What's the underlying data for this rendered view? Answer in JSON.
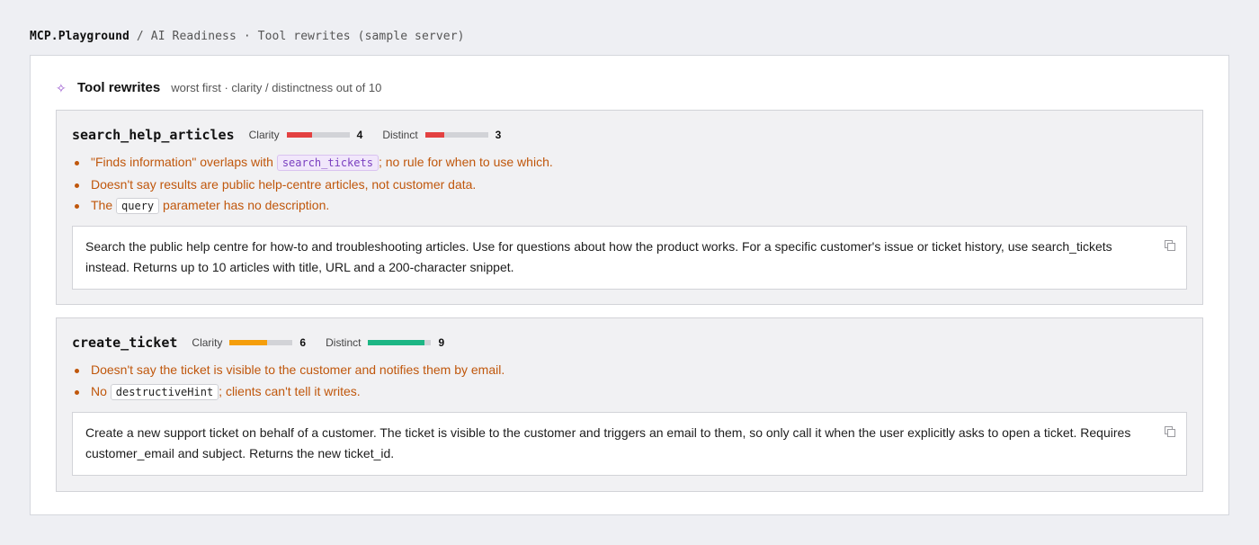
{
  "breadcrumb": {
    "brand": "MCP.Playground",
    "path": "/ AI Readiness · Tool rewrites (sample server)"
  },
  "panel": {
    "icon": "sparkle-icon",
    "title": "Tool rewrites",
    "subtitle": "worst first · clarity / distinctness out of 10"
  },
  "colors": {
    "low": "#e34141",
    "mid": "#f59e0b",
    "high": "#1db684",
    "issue_text": "#c0570c"
  },
  "tools": [
    {
      "name": "search_help_articles",
      "clarity_label": "Clarity",
      "clarity": 4,
      "distinct_label": "Distinct",
      "distinct": 3,
      "issues": [
        {
          "before": "\"Finds information\" overlaps with ",
          "code": "search_tickets",
          "after": "; no rule for when to use which."
        },
        {
          "before": "Doesn't say results are public help-centre articles, not customer data."
        },
        {
          "before": "The ",
          "code": "query",
          "after": " parameter has no description."
        }
      ],
      "rewrite": "Search the public help centre for how-to and troubleshooting articles. Use for questions about how the product works. For a specific customer's issue or ticket history, use search_tickets instead. Returns up to 10 articles with title, URL and a 200-character snippet."
    },
    {
      "name": "create_ticket",
      "clarity_label": "Clarity",
      "clarity": 6,
      "distinct_label": "Distinct",
      "distinct": 9,
      "issues": [
        {
          "before": "Doesn't say the ticket is visible to the customer and notifies them by email."
        },
        {
          "before": "No ",
          "code": "destructiveHint",
          "after": "; clients can't tell it writes."
        }
      ],
      "rewrite": "Create a new support ticket on behalf of a customer. The ticket is visible to the customer and triggers an email to them, so only call it when the user explicitly asks to open a ticket. Requires customer_email and subject. Returns the new ticket_id."
    }
  ]
}
